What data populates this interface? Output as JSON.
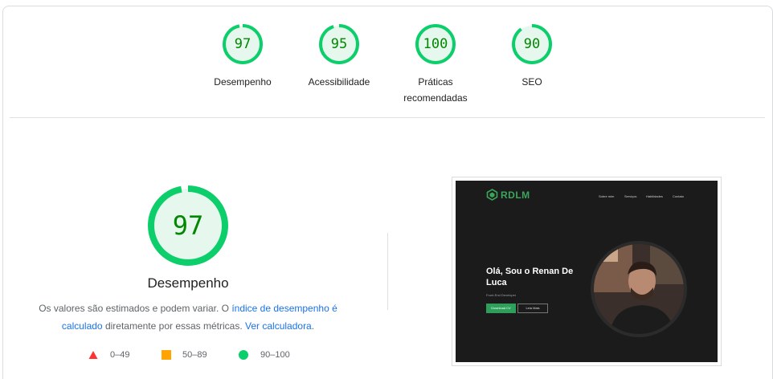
{
  "colors": {
    "good": "#0cce6b",
    "good_text": "#008800",
    "good_fill": "#e6f7ed",
    "average": "#ffa400",
    "fail": "#ff3333",
    "link": "#1a73e8"
  },
  "categories": [
    {
      "label": "Desempenho",
      "score": 97
    },
    {
      "label": "Acessibilidade",
      "score": 95
    },
    {
      "label": "Práticas recomendadas",
      "score": 100
    },
    {
      "label": "SEO",
      "score": 90
    }
  ],
  "performance": {
    "score": 97,
    "title": "Desempenho",
    "desc_before": "Os valores são estimados e podem variar. O ",
    "link_score_calc": "índice de desempenho é calculado",
    "desc_middle": " diretamente por essas métricas. ",
    "link_calculator": "Ver calculadora",
    "desc_after": "."
  },
  "legend": [
    {
      "shape": "triangle",
      "range": "0–49"
    },
    {
      "shape": "square",
      "range": "50–89"
    },
    {
      "shape": "circle",
      "range": "90–100"
    }
  ],
  "screenshot": {
    "logo": "RDLM",
    "nav": [
      "Sobre mim",
      "Serviços",
      "Habilidades",
      "Contato"
    ],
    "hero_title": "Olá, Sou o Renan De Luca",
    "hero_sub": "Front-End Developer",
    "btn_primary": "Download CV",
    "btn_secondary": "Leia Mais"
  }
}
